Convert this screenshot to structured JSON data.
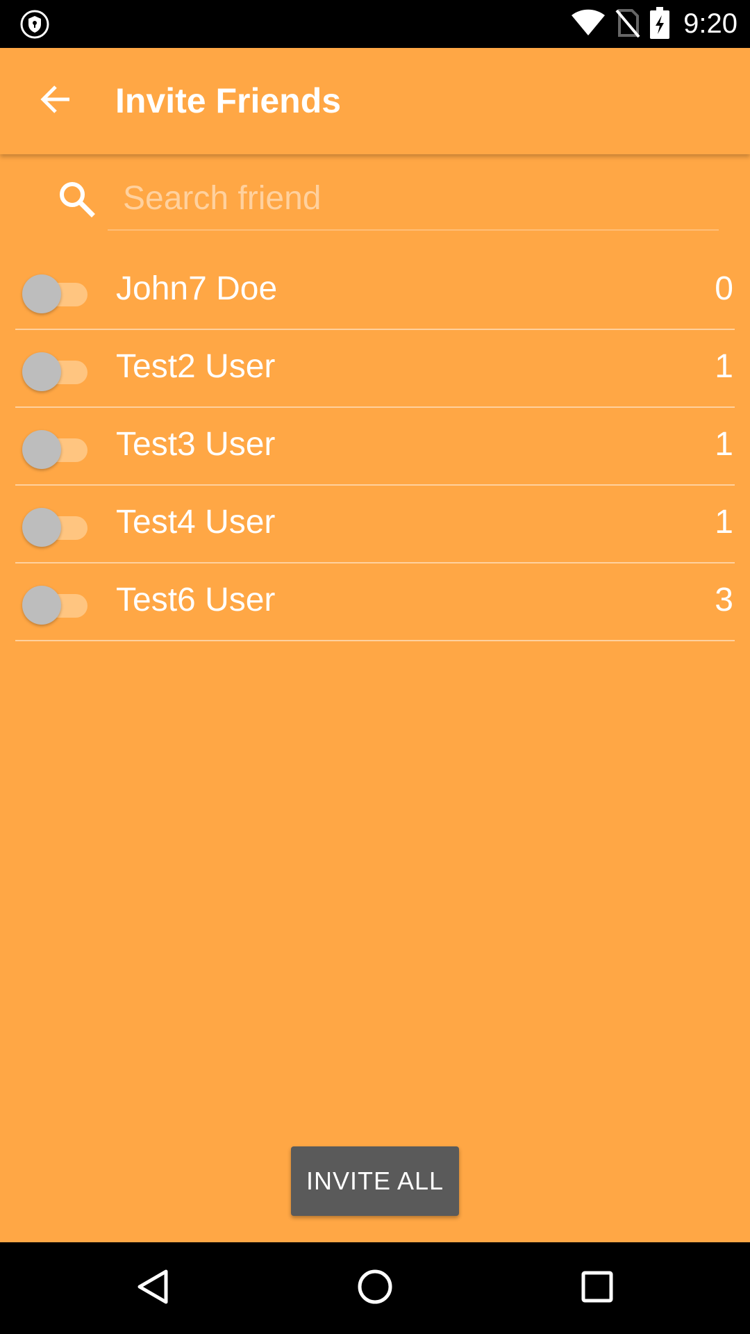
{
  "status_bar": {
    "time": "9:20",
    "icons": [
      "vpn-shield-icon",
      "wifi-icon",
      "no-sim-icon",
      "battery-charging-icon"
    ]
  },
  "app_bar": {
    "title": "Invite Friends",
    "back_icon": "arrow-back-icon"
  },
  "search": {
    "placeholder": "Search friend",
    "value": "",
    "icon": "search-icon"
  },
  "friends": [
    {
      "name": "John7 Doe",
      "count": "0",
      "selected": false
    },
    {
      "name": "Test2 User",
      "count": "1",
      "selected": false
    },
    {
      "name": "Test3 User",
      "count": "1",
      "selected": false
    },
    {
      "name": "Test4 User",
      "count": "1",
      "selected": false
    },
    {
      "name": "Test6 User",
      "count": "3",
      "selected": false
    }
  ],
  "invite_all": {
    "label": "INVITE ALL"
  },
  "nav_bar": {
    "icons": [
      "back-triangle-icon",
      "home-circle-icon",
      "recents-square-icon"
    ]
  },
  "colors": {
    "background": "#FFA745",
    "button": "#5A5A5A",
    "toggle_thumb": "#BDBDBD"
  }
}
